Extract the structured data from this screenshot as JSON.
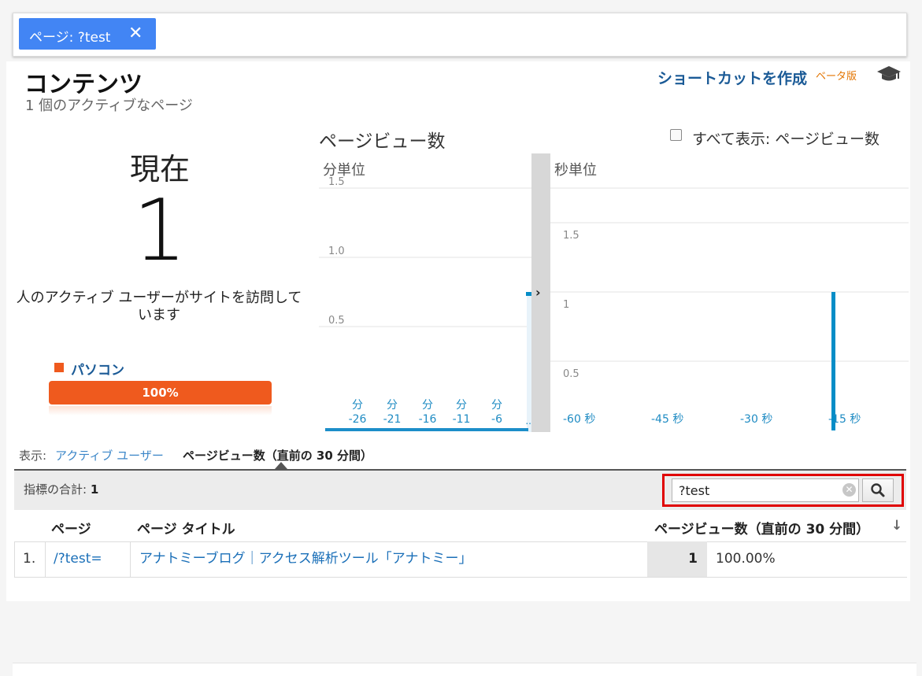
{
  "filter": {
    "label": "ページ: ?test",
    "close": "✕"
  },
  "header": {
    "title": "コンテンツ",
    "subtitle": "1 個のアクティブなページ",
    "shortcut": "ショートカットを作成",
    "beta": "ベータ版"
  },
  "now": {
    "label": "現在",
    "count": "1",
    "description": "人のアクティブ ユーザーがサイトを訪問していますす"
  },
  "device": {
    "label": "パソコン",
    "percent": "100%",
    "color": "#ef5a1e"
  },
  "charts": {
    "title": "ページビュー数",
    "show_all_label": "すべて表示: ページビュー数",
    "show_all_checked": false,
    "minute": {
      "head": "分単位",
      "y_ticks": [
        "1.5",
        "1.0",
        "0.5"
      ],
      "x_top": [
        "分",
        "分",
        "分",
        "分",
        "分"
      ],
      "x_bottom": [
        "-26",
        "-21",
        "-16",
        "-11",
        "-6"
      ],
      "trailing": ".."
    },
    "second": {
      "head": "秒単位",
      "y_ticks": [
        "1.5",
        "1",
        "0.5"
      ],
      "x_labels": [
        "-60 秒",
        "-45 秒",
        "-30 秒",
        "-15 秒"
      ]
    }
  },
  "chart_data": [
    {
      "type": "bar",
      "title": "分単位",
      "x": [
        -30,
        -29,
        -28,
        -27,
        -26,
        -25,
        -24,
        -23,
        -22,
        -21,
        -20,
        -19,
        -18,
        -17,
        -16,
        -15,
        -14,
        -13,
        -12,
        -11,
        -10,
        -9,
        -8,
        -7,
        -6,
        -5,
        -4,
        -3,
        -2,
        -1
      ],
      "values": [
        0,
        0,
        0,
        0,
        0,
        0,
        0,
        0,
        0,
        0,
        0,
        0,
        0,
        0,
        0,
        0,
        0,
        0,
        0,
        0,
        0,
        0,
        0,
        0,
        0,
        0,
        0,
        0,
        0,
        1
      ],
      "ylim": [
        0,
        2
      ]
    },
    {
      "type": "bar",
      "title": "秒単位",
      "x_ticks": [
        "-60 秒",
        "-45 秒",
        "-30 秒",
        "-15 秒"
      ],
      "bars": [
        {
          "x": -15,
          "value": 1
        }
      ],
      "xlim": [
        -60,
        0
      ],
      "ylim": [
        0,
        2
      ]
    }
  ],
  "show": {
    "label": "表示:",
    "active_users": "アクティブ ユーザー",
    "pageviews": "ページビュー数（直前の 30 分間）"
  },
  "metrics": {
    "label": "指標の合計:",
    "value": "1"
  },
  "search": {
    "value": "?test",
    "clear": "✕"
  },
  "table": {
    "headers": [
      "ページ",
      "ページ タイトル",
      "ページビュー数（直前の 30 分間）"
    ],
    "rows": [
      {
        "index": "1.",
        "page": "/?test=",
        "title": "アナトミーブログ｜アクセス解析ツール「アナトミー」",
        "views": "1",
        "percent": "100.00%"
      }
    ]
  },
  "colors": {
    "accent": "#4285f4",
    "link": "#1a5a96",
    "bar": "#058dc7",
    "highlight": "#e00000"
  }
}
